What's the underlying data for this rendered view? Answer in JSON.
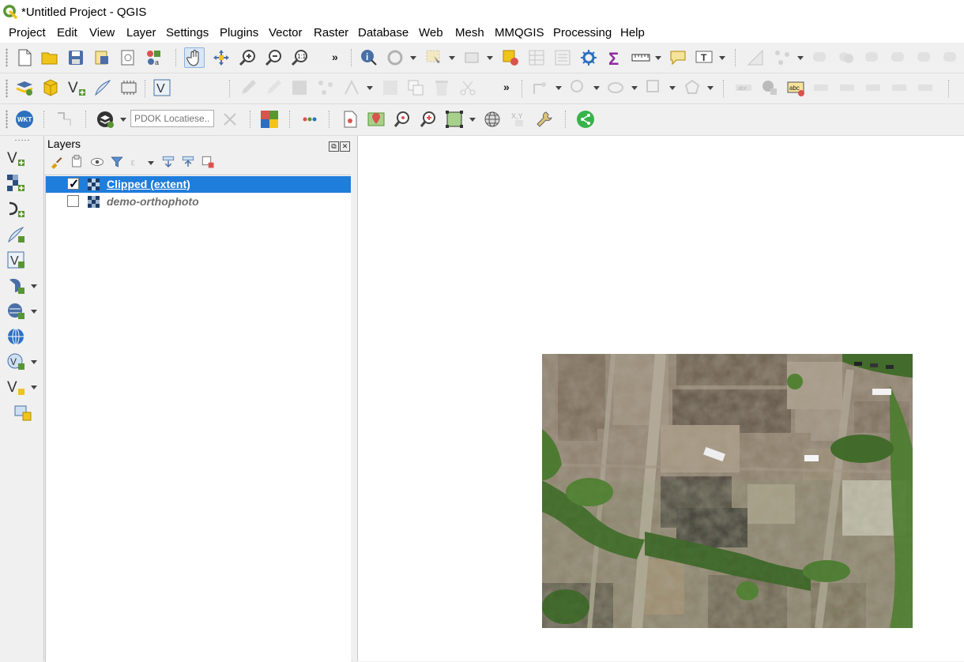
{
  "window": {
    "title": "*Untitled Project - QGIS"
  },
  "menu": [
    "Project",
    "Edit",
    "View",
    "Layer",
    "Settings",
    "Plugins",
    "Vector",
    "Raster",
    "Database",
    "Web",
    "Mesh",
    "MMQGIS",
    "Processing",
    "Help"
  ],
  "toolbar": {
    "overflow_label": "»",
    "locator_placeholder": "PDOK Locatiese...",
    "wkt_label": "WKT"
  },
  "layers_panel": {
    "title": "Layers",
    "layers": [
      {
        "name": "Clipped (extent)",
        "checked": true,
        "selected": true
      },
      {
        "name": "demo-orthophoto",
        "checked": false,
        "selected": false
      }
    ]
  },
  "icons": [
    "qgis-logo-icon",
    "new-project-icon",
    "open-project-icon",
    "save-project-icon",
    "pan-icon",
    "zoom-in-icon",
    "zoom-out-icon",
    "identify-icon",
    "field-calculator-icon",
    "statistics-icon",
    "map-tips-icon",
    "add-vector-layer-icon",
    "add-raster-layer-icon",
    "plugin-icon",
    "measure-icon"
  ],
  "colors": {
    "selection": "#1f7ddb",
    "qgis_green": "#589632",
    "qgis_yellow": "#f0c419"
  }
}
